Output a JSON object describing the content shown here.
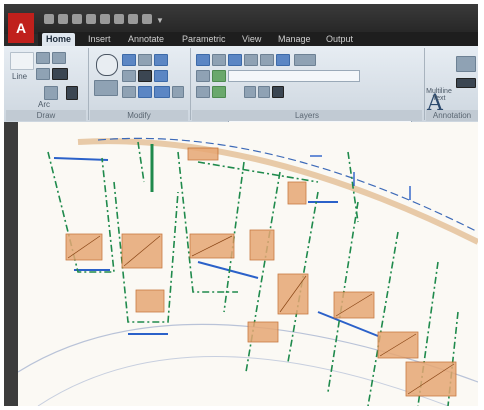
{
  "app": {
    "logo_glyph": "A",
    "title_text": ""
  },
  "tabs": [
    "Home",
    "Insert",
    "Annotate",
    "Parametric",
    "View",
    "Manage",
    "Output",
    ""
  ],
  "active_tab_index": 0,
  "ribbon": {
    "panels": [
      {
        "title": "Draw"
      },
      {
        "title": "Modify"
      },
      {
        "title": "Layers"
      },
      {
        "title": "Annotation"
      }
    ],
    "draw_labels": [
      "Line",
      "Arc"
    ],
    "text_tool_label": "Multiline Text",
    "layer_combo_value": ""
  },
  "colors": {
    "accent": "#c0201c",
    "ribbon_bg": "#dde4eb",
    "canvas_bg": "#fbf9f4",
    "parcel_line": "#1f8a4c",
    "street_blue": "#2b61c9",
    "building_hatch": "#d9833c"
  }
}
